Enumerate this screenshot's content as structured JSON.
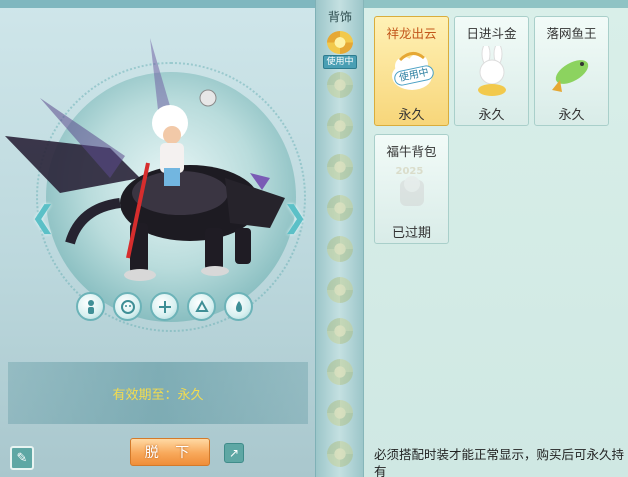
{
  "strip": {
    "title": "背饰",
    "in_use_label": "使用中",
    "item_count": 11
  },
  "preview": {
    "validity_text": "有效期至：永久",
    "remove_label": "脱 下",
    "tool_icons": [
      "character-icon",
      "face-icon",
      "plus-icon",
      "mount-action-icon",
      "dye-icon"
    ]
  },
  "items": [
    {
      "name": "祥龙出云",
      "status": "永久",
      "badge": "使用中",
      "selected": true,
      "expired": false
    },
    {
      "name": "日进斗金",
      "status": "永久",
      "badge": "",
      "selected": false,
      "expired": false
    },
    {
      "name": "落网鱼王",
      "status": "永久",
      "badge": "",
      "selected": false,
      "expired": false
    },
    {
      "name": "福牛背包",
      "status": "已过期",
      "badge": "",
      "selected": false,
      "expired": true,
      "year": "2025"
    }
  ],
  "footer": {
    "tip": "必须搭配时装才能正常显示，购买后可永久持有"
  },
  "colors": {
    "accent_teal": "#5ea7a4",
    "highlight_yellow": "#f3dc4f",
    "button_orange": "#f8a85a",
    "selected_card": "#f7d67a"
  }
}
